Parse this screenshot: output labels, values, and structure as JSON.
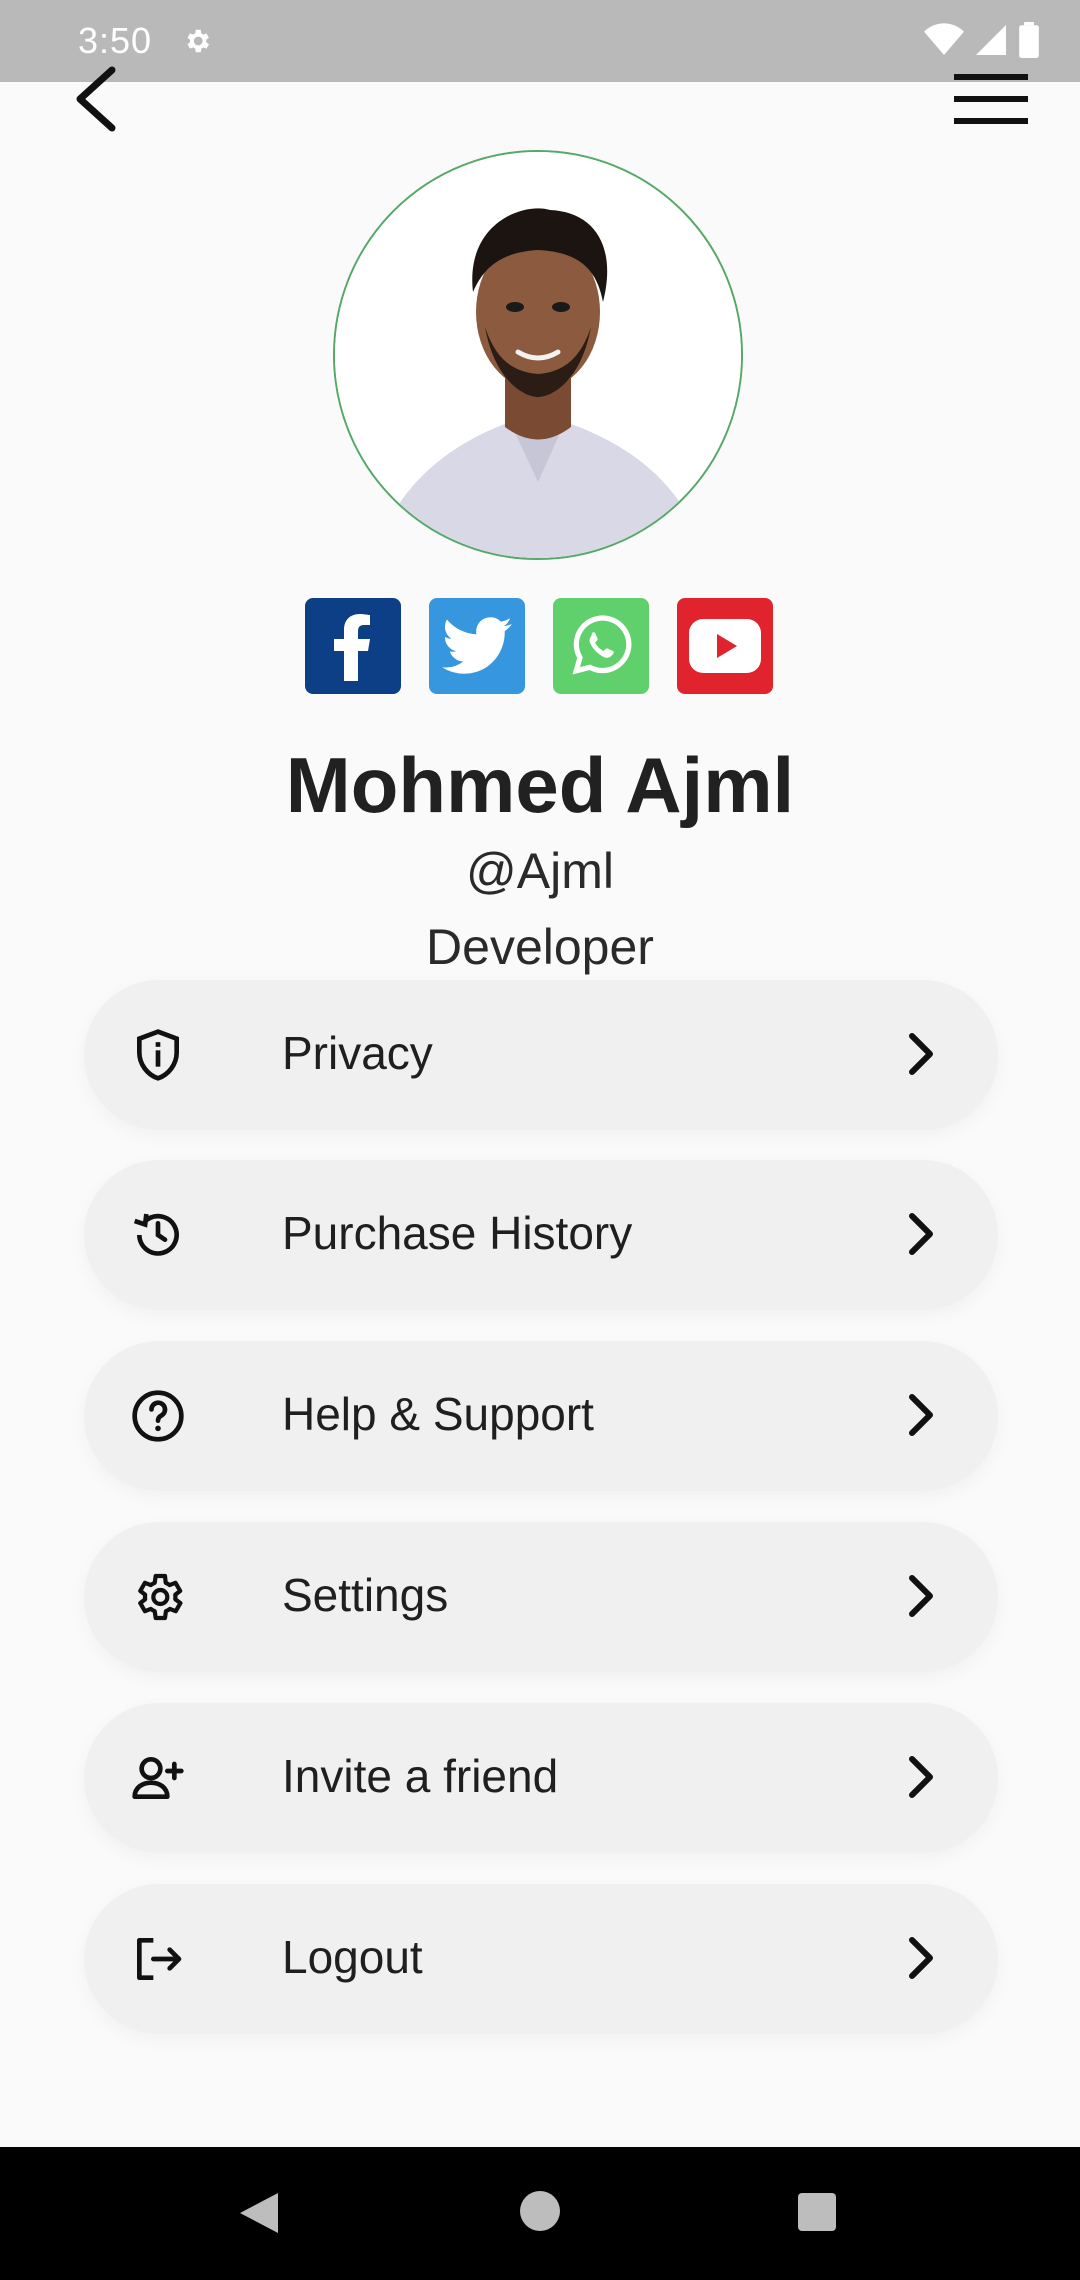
{
  "status_bar": {
    "time": "3:50"
  },
  "profile": {
    "name": "Mohmed Ajml",
    "handle": "@Ajml",
    "role": "Developer"
  },
  "social": [
    {
      "name": "facebook-icon",
      "color": "#0d3f86"
    },
    {
      "name": "twitter-icon",
      "color": "#3696de"
    },
    {
      "name": "whatsapp-icon",
      "color": "#5fd06b"
    },
    {
      "name": "youtube-icon",
      "color": "#e0232c"
    }
  ],
  "menu": {
    "items": [
      {
        "label": "Privacy",
        "icon": "shield-info-icon"
      },
      {
        "label": "Purchase History",
        "icon": "history-icon"
      },
      {
        "label": "Help & Support",
        "icon": "help-circle-icon"
      },
      {
        "label": "Settings",
        "icon": "gear-icon"
      },
      {
        "label": "Invite a friend",
        "icon": "add-user-icon"
      },
      {
        "label": "Logout",
        "icon": "logout-icon"
      }
    ]
  },
  "colors": {
    "avatar_ring": "#55a868",
    "menu_bg": "#f0f0f0"
  }
}
